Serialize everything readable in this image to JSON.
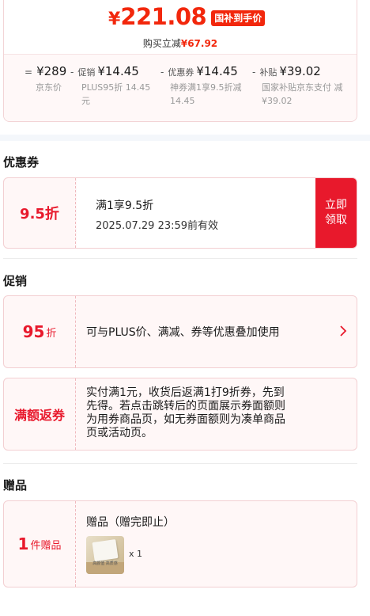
{
  "price_summary": {
    "currency": "¥",
    "hand_price": "221.08",
    "badge": "国补到手价",
    "save_label": "购买立减",
    "save_amount": "¥67.92",
    "breakdown": [
      {
        "op": "=",
        "label": "",
        "value": "¥289",
        "sub": "京东价"
      },
      {
        "op": "-",
        "label": "促销",
        "value": "¥14.45",
        "sub": "PLUS95折 14.45元"
      },
      {
        "op": "-",
        "label": "优惠券",
        "value": "¥14.45",
        "sub": "神券满1享9.5折减 14.45"
      },
      {
        "op": "-",
        "label": "补贴",
        "value": "¥39.02",
        "sub": "国家补贴京东支付 减¥39.02"
      }
    ]
  },
  "coupon_section": {
    "title": "优惠券",
    "coupon": {
      "discount": "9.5折",
      "condition": "满1享9.5折",
      "validity": "2025.07.29 23:59前有效",
      "claim_line1": "立即",
      "claim_line2": "领取"
    }
  },
  "promo_section": {
    "title": "促销",
    "plus": {
      "value": "95",
      "unit": "折",
      "text": "可与PLUS价、满减、券等优惠叠加使用"
    },
    "rebate": {
      "label": "满额返券",
      "lines": [
        "实付满1元，收货后返满1打9折券，先到",
        "先得。若点击跳转后的页面展示券面额则",
        "为用券商品页，如无券面额则为凑单商品",
        "页或活动页。"
      ]
    }
  },
  "gift_section": {
    "title": "赠品",
    "count": "1",
    "count_unit": "件赠品",
    "label": "赠品（赠完即止）",
    "thumb_text": "高颜值 高质感",
    "qty": "x 1"
  },
  "colors": {
    "accent": "#e8192c",
    "price_red": "#f2270c",
    "card_bg": "#fff7f7",
    "card_border": "#f3cfd2"
  },
  "icons": {
    "chevron": "chevron-right-icon"
  }
}
